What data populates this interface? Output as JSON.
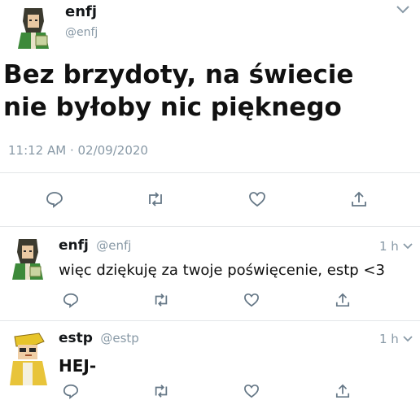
{
  "main_tweet": {
    "display_name": "enfj",
    "handle": "@enfj",
    "text_line1": "Bez brzydoty, na świecie",
    "text_line2": "nie byłoby nic pięknego",
    "timestamp": "11:12 AM · 02/09/2020",
    "actions": [
      "reply-icon",
      "retweet-icon",
      "like-icon",
      "share-icon"
    ]
  },
  "replies": [
    {
      "display_name": "enfj",
      "handle": "@enfj",
      "time": "1 h",
      "text": "więc dziękuję za twoje poświęcenie, estp <3",
      "avatar": "green-book-character-avatar"
    },
    {
      "display_name": "estp",
      "handle": "@estp",
      "time": "1 h",
      "text": "HEJ-",
      "avatar": "yellow-cap-character-avatar"
    }
  ],
  "colors": {
    "text": "#14171a",
    "muted": "#8899a6",
    "icon": "#657786",
    "divider": "#e3e6e8"
  }
}
